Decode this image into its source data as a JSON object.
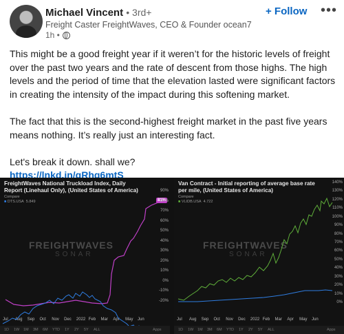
{
  "author": {
    "name": "Michael Vincent",
    "degree": "• 3rd+",
    "headline": "Freight Caster FreightWaves, CEO & Founder ocean7m...",
    "time": "1h •"
  },
  "actions": {
    "follow_label": "+ Follow",
    "more_label": "•••"
  },
  "post": {
    "p1": "This might be a good freight year if it weren’t for the historic levels of freight over the past two years and the rate of descent from those highs. The high levels and the period of time that the elevation lasted were significant factors in creating the intensity of the impact during this softening market.",
    "p2": "The fact that this is the second-highest freight market in the past five years means nothing. It’s really just an interesting fact.",
    "p3": "Let's break it down. shall we?",
    "link": "https://lnkd.in/gRhg6mtS"
  },
  "colors": {
    "brand": "#0a66c2",
    "blue_series": "#2f7de1",
    "purple_series": "#c040c8",
    "green_series": "#5fae3a"
  },
  "watermark": {
    "brand": "FREIGHTWAVES",
    "product": "SONAR"
  },
  "charts": {
    "left": {
      "title": "FreightWaves National Truckload Index, Daily Report (Linehaul Only), (United States of America)",
      "legend1": "Compare",
      "legend2": "DTS.USA",
      "legend3": "5.849",
      "badge": "81%",
      "y_ticks": [
        "90%",
        "80%",
        "70%",
        "60%",
        "50%",
        "40%",
        "30%",
        "20%",
        "10%",
        "0%",
        "-10%",
        "-20%"
      ],
      "x_ticks": [
        "Jul",
        "Aug",
        "Sep",
        "Oct",
        "Nov",
        "Dec",
        "2022",
        "Feb",
        "Mar",
        "Apr",
        "May",
        "Jun"
      ],
      "controls": [
        "1D",
        "1W",
        "1M",
        "3M",
        "6M",
        "YTD",
        "1Y",
        "2Y",
        "5Y",
        "ALL"
      ],
      "app": "Apps"
    },
    "right": {
      "title": "Van Contract - Initial reporting of average base rate per mile, (United States of America)",
      "legend1": "Compare",
      "legend2": "VLIDB.USA",
      "legend3": "4.722",
      "y_ticks": [
        "140%",
        "130%",
        "120%",
        "110%",
        "100%",
        "90%",
        "80%",
        "70%",
        "60%",
        "50%",
        "40%",
        "30%",
        "20%",
        "10%",
        "0%"
      ],
      "x_ticks": [
        "Jul",
        "Aug",
        "Sep",
        "Oct",
        "Nov",
        "Dec",
        "2022",
        "Feb",
        "Mar",
        "Apr",
        "May",
        "Jun"
      ],
      "controls": [
        "1D",
        "1W",
        "1M",
        "3M",
        "6M",
        "YTD",
        "1Y",
        "2Y",
        "5Y",
        "ALL"
      ],
      "app": "Apps"
    }
  }
}
